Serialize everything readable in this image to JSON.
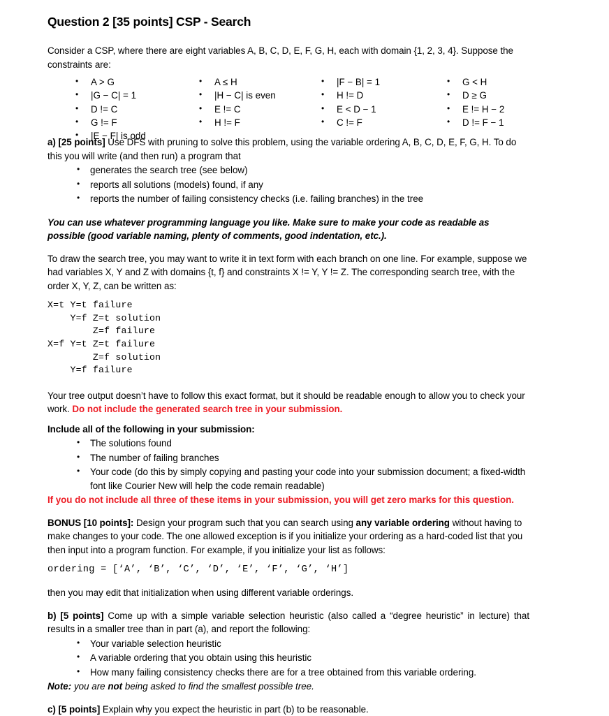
{
  "title": "Question 2 [35 points] CSP - Search",
  "intro": "Consider a CSP, where there are eight variables A, B, C, D, E, F, G, H, each with domain {1, 2, 3, 4}. Suppose the constraints are:",
  "constraints": {
    "column1": [
      "A > G",
      "|G − C| = 1",
      "D != C",
      "G != F",
      "|E − F| is odd"
    ],
    "column2": [
      "A ≤ H",
      "|H − C| is even",
      "E != C",
      "H != F"
    ],
    "column3": [
      "|F − B| = 1",
      "H != D",
      "E < D − 1",
      "C != F"
    ],
    "column4": [
      "G < H",
      "D ≥ G",
      "E != H − 2",
      "D != F − 1"
    ]
  },
  "part_a": {
    "label": "a) [25 points]",
    "text": " Use DFS with pruning to solve this problem, using the variable ordering A, B, C, D, E, F, G, H. To do this you will write (and then run) a program that",
    "bullets": [
      "generates the search tree (see below)",
      "reports all solutions (models) found, if any",
      "reports the number of failing consistency checks (i.e. failing branches) in the tree"
    ],
    "emphasis": "You can use whatever programming language you like.  Make sure to make your code as readable as possible (good variable naming, plenty of comments, good indentation, etc.).",
    "tree_intro": "To draw the search tree, you may want to write it in text form with each branch on one line. For example, suppose we had variables X, Y and Z with domains {t, f} and constraints X != Y, Y != Z. The corresponding search tree, with the order X, Y, Z, can be written as:",
    "tree_example": "X=t Y=t failure\n    Y=f Z=t solution\n        Z=f failure\nX=f Y=t Z=t failure\n        Z=f solution\n    Y=f failure",
    "tree_note_plain": "Your tree output doesn’t have to follow this exact format, but it should be readable enough to allow you to check your work.  ",
    "tree_note_red": "Do not include the generated search tree in your submission."
  },
  "submission": {
    "heading": "Include all of the following in your submission:",
    "bullets": [
      "The solutions found",
      "The number of failing branches",
      "Your code (do this by simply copying and pasting your code into your submission document; a fixed-width font like Courier New will help the code remain readable)"
    ],
    "warning": "If you do not include all three of these items in your submission, you will get zero marks for this question."
  },
  "bonus": {
    "label": "BONUS [10 points]:",
    "text_before": " Design your program such that you can search using ",
    "bold_phrase": "any variable ordering",
    "text_after": " without having to make changes to your code.  The one allowed exception is if you initialize your ordering as a hard-coded list that you then input into a program function.  For example, if you initialize your list as follows:",
    "code_line": "ordering = [‘A’, ‘B’, ‘C’, ‘D’, ‘E’, ‘F’, ‘G’, ‘H’]",
    "closing": "then you may edit that initialization when using different variable orderings."
  },
  "part_b": {
    "label": "b) [5 points]",
    "text": " Come up with a simple variable selection heuristic (also called a “degree heuristic” in lecture) that results in a smaller tree than in part (a), and report the following:",
    "bullets": [
      "Your variable selection heuristic",
      "A variable ordering that you obtain using this heuristic",
      "How many failing consistency checks there are for a tree obtained from this variable ordering."
    ],
    "note_label": "Note:",
    "note_text_1": " you are ",
    "note_bold": "not",
    "note_text_2": " being asked to find the smallest possible tree."
  },
  "part_c": {
    "label": "c) [5 points]",
    "text": " Explain why you expect the heuristic in part (b) to be reasonable."
  }
}
